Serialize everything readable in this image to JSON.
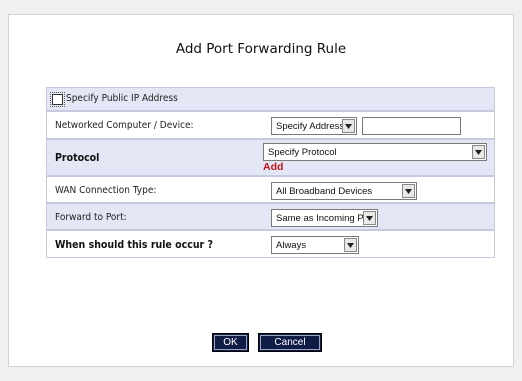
{
  "dialog": {
    "title": "Add Port Forwarding Rule"
  },
  "rows": {
    "public_ip": {
      "label": "Specify Public IP Address",
      "checked": false
    },
    "networked_device": {
      "label": "Networked Computer / Device:",
      "select_value": "Specify Address",
      "input_value": ""
    },
    "protocol": {
      "label": "Protocol",
      "select_value": "Specify Protocol",
      "add_link": "Add"
    },
    "wan_type": {
      "label": "WAN Connection Type:",
      "select_value": "All Broadband Devices"
    },
    "forward_port": {
      "label": "Forward to Port:",
      "select_value": "Same as Incoming Port"
    },
    "schedule": {
      "label": "When should this rule occur ?",
      "select_value": "Always"
    }
  },
  "buttons": {
    "ok": "OK",
    "cancel": "Cancel"
  },
  "colors": {
    "row_bg": "#e3e6f4",
    "button_bg": "#0f1d46",
    "add_link": "#c0121b"
  },
  "icons": {
    "dropdown": "chevron-down-icon"
  }
}
